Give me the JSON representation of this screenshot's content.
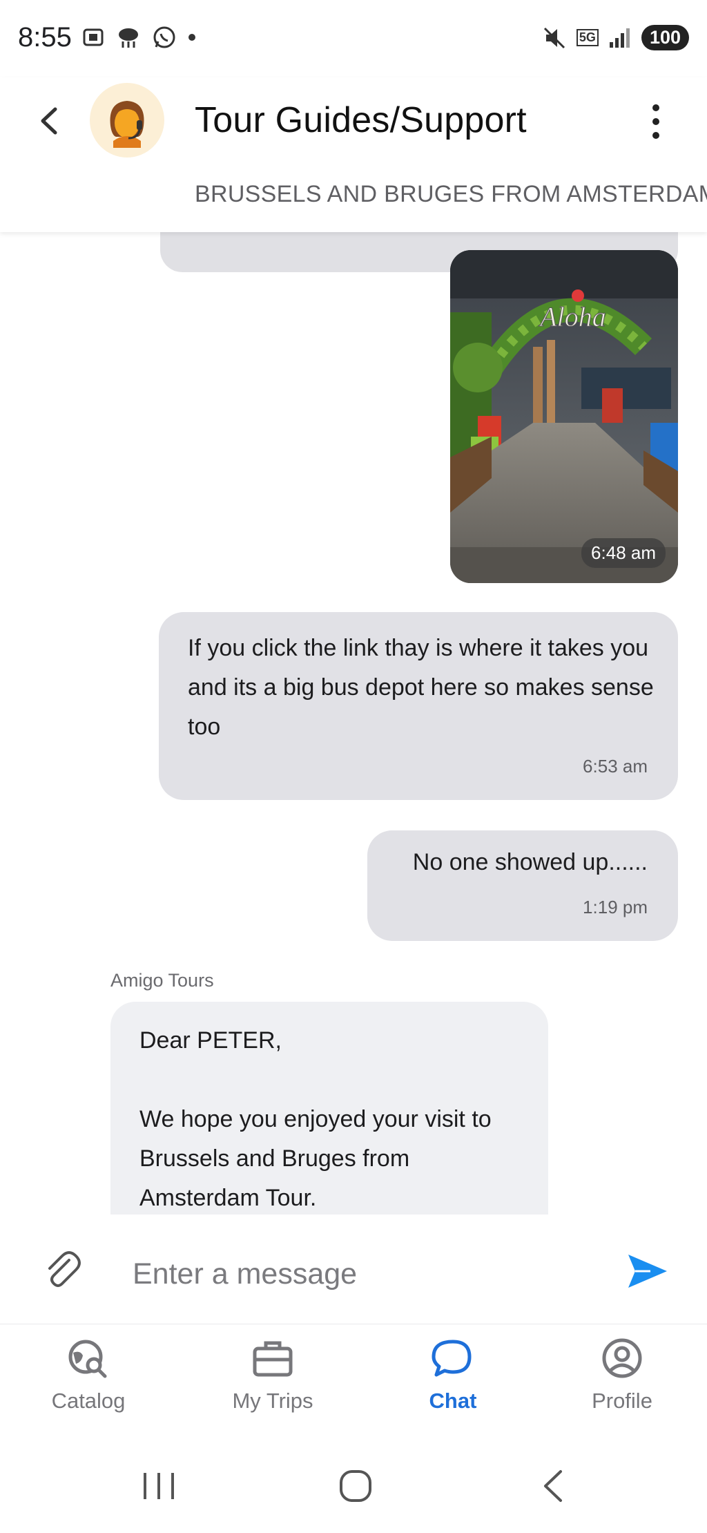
{
  "status_bar": {
    "time": "8:55",
    "battery": "100",
    "network": "5G"
  },
  "header": {
    "title": "Tour Guides/Support",
    "subtitle": "BRUSSELS AND BRUGES FROM AMSTERDAM"
  },
  "messages": [
    {
      "type": "image",
      "direction": "outgoing",
      "time": "6:48 am",
      "image_text": "Aloha"
    },
    {
      "type": "text",
      "direction": "outgoing",
      "text": "If you click the link thay is where it takes you and its a big bus depot here so makes sense too",
      "time": "6:53 am"
    },
    {
      "type": "text",
      "direction": "outgoing",
      "text": "No one showed up......",
      "time": "1:19 pm"
    },
    {
      "type": "text",
      "direction": "incoming",
      "sender": "Amigo Tours",
      "text": "Dear PETER,\n\nWe hope you enjoyed your visit to Brussels and Bruges from Amsterdam Tour."
    }
  ],
  "composer": {
    "placeholder": "Enter a message"
  },
  "nav": {
    "items": [
      {
        "label": "Catalog",
        "icon": "catalog-icon",
        "active": false
      },
      {
        "label": "My Trips",
        "icon": "briefcase-icon",
        "active": false
      },
      {
        "label": "Chat",
        "icon": "chat-icon",
        "active": true
      },
      {
        "label": "Profile",
        "icon": "profile-icon",
        "active": false
      }
    ]
  },
  "colors": {
    "accent": "#1e6fd9",
    "send": "#1a8ef0",
    "bubble_out": "#e1e1e6",
    "bubble_in": "#eff0f3"
  }
}
